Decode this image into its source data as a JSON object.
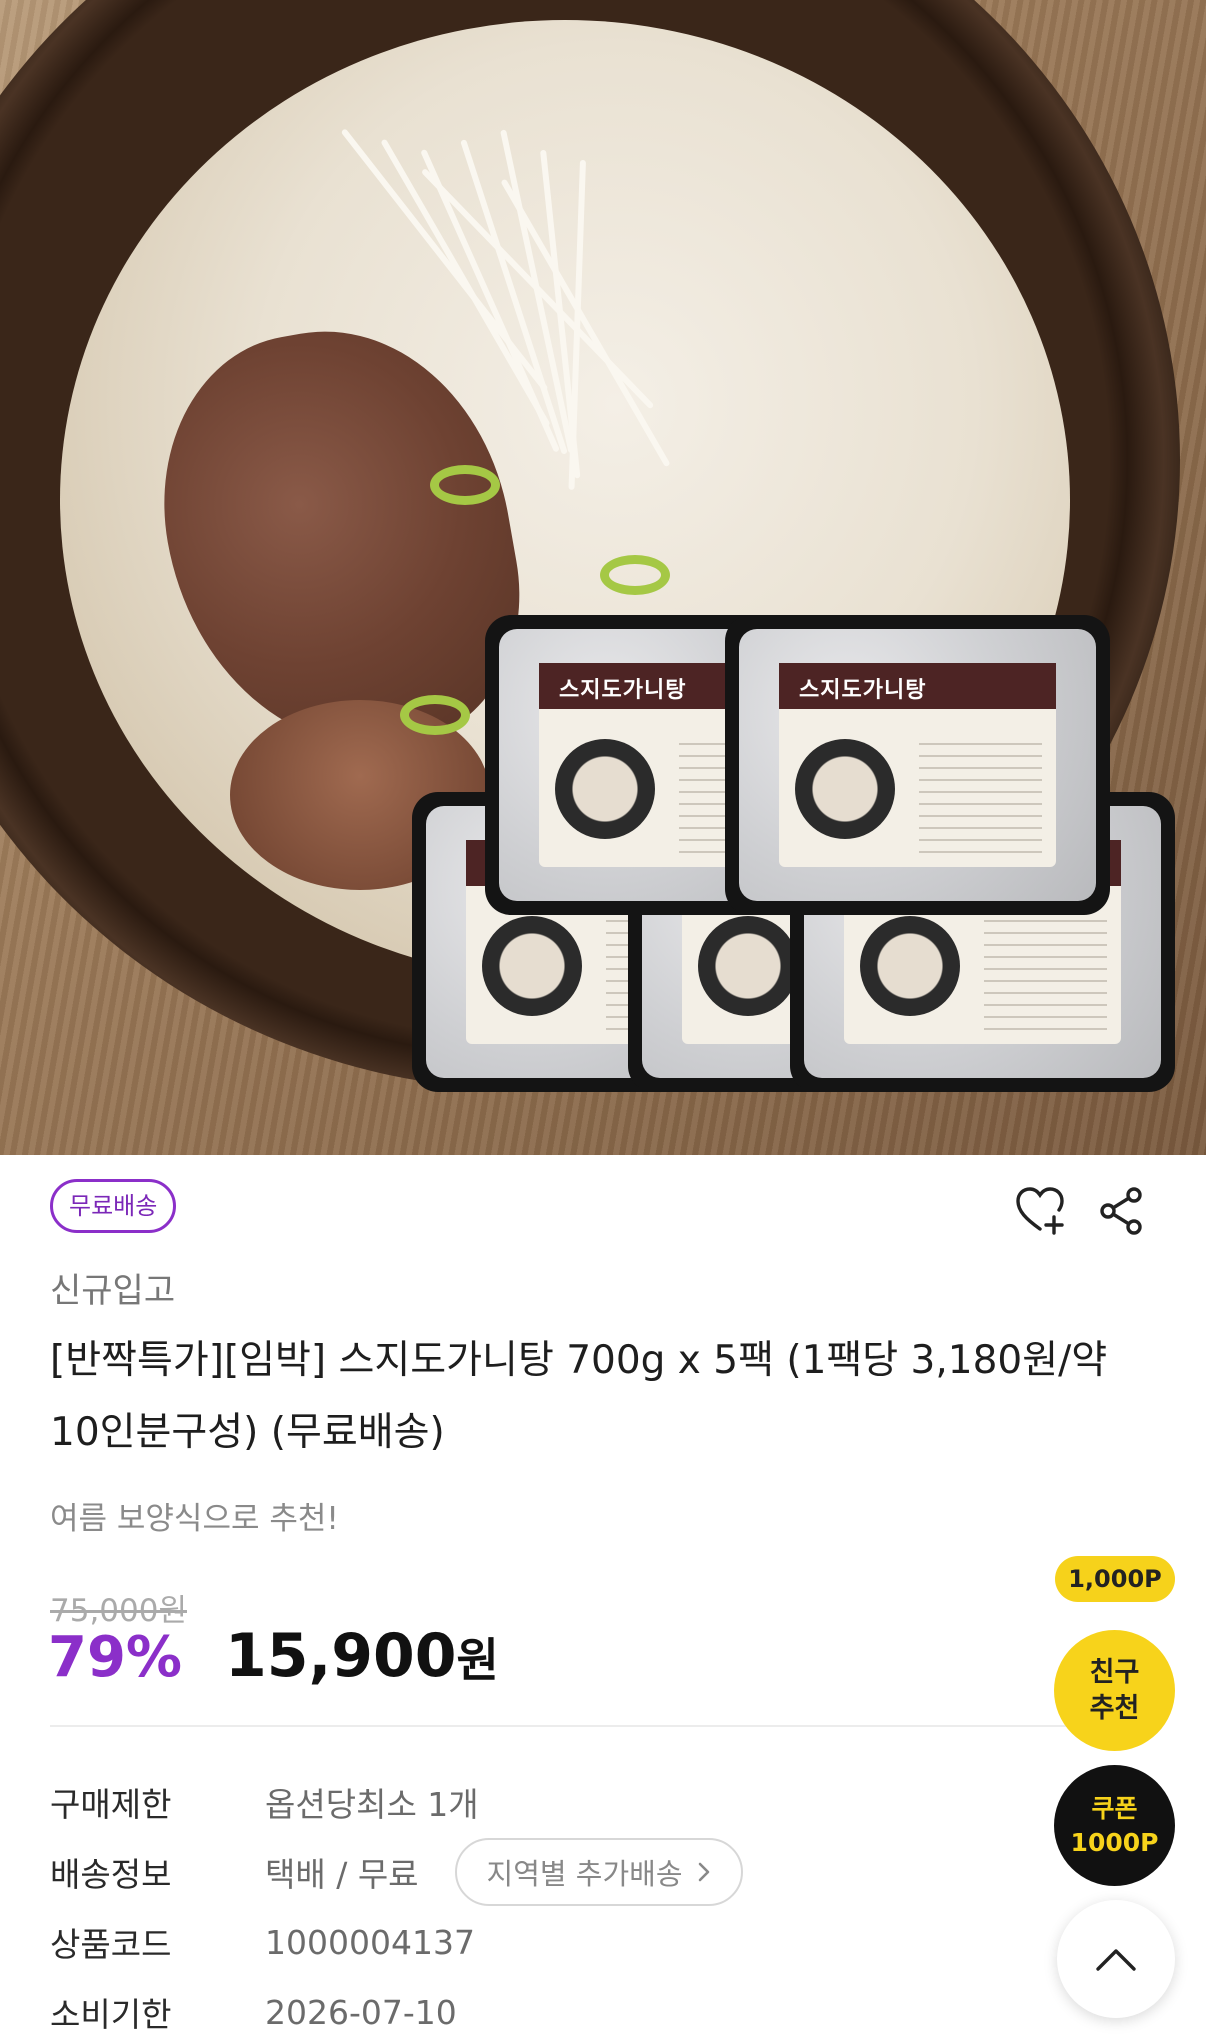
{
  "hero": {
    "pack_label": "스지도가니탕",
    "image_alt_icon": "product-photo"
  },
  "product": {
    "free_shipping_badge": "무료배송",
    "new_label": "신규입고",
    "title": "[반짝특가][임박] 스지도가니탕 700g x 5팩 (1팩당 3,180원/약 10인분구성) (무료배송)",
    "subtitle": "여름 보양식으로 추천!",
    "original_price": "75,000원",
    "discount_rate": "79%",
    "sale_price": "15,900",
    "currency": "원"
  },
  "actions": {
    "wishlist_icon": "heart-plus-icon",
    "share_icon": "share-icon"
  },
  "specs": [
    {
      "key": "구매제한",
      "value": "옵션당최소 1개"
    },
    {
      "key": "배송정보",
      "value": "택배 / 무료",
      "button": "지역별 추가배송"
    },
    {
      "key": "상품코드",
      "value": "1000004137"
    },
    {
      "key": "소비기한",
      "value": "2026-07-10"
    }
  ],
  "floating": {
    "point_tag": "1,000P",
    "friend_line1": "친구",
    "friend_line2": "추천",
    "coupon_line1": "쿠폰",
    "coupon_line2": "1000P",
    "scroll_top_icon": "chevron-up-icon"
  },
  "colors": {
    "accent": "#8b2fc9",
    "yellow": "#f7d31b"
  }
}
